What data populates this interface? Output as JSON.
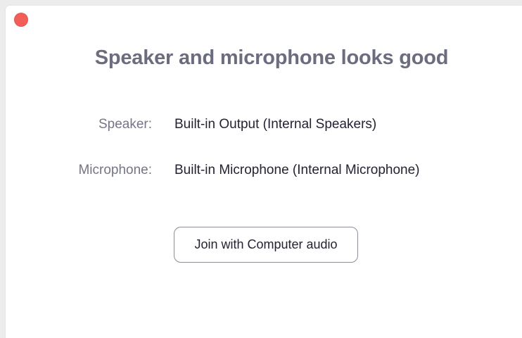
{
  "window": {
    "close_color": "#f25f58"
  },
  "heading": "Speaker and microphone looks good",
  "devices": {
    "speaker_label": "Speaker:",
    "speaker_value": "Built-in Output (Internal Speakers)",
    "microphone_label": "Microphone:",
    "microphone_value": "Built-in Microphone (Internal Microphone)"
  },
  "actions": {
    "join_label": "Join with Computer audio"
  }
}
